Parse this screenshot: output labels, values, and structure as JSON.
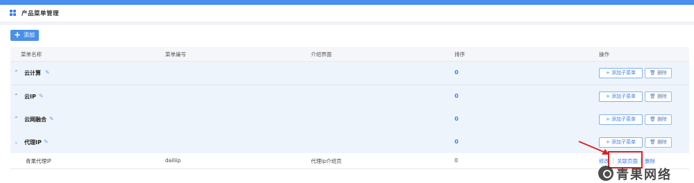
{
  "page": {
    "title": "产品菜单管理"
  },
  "toolbar": {
    "add_label": "添加"
  },
  "table": {
    "headers": [
      "菜单名称",
      "菜单编号",
      "介绍界面",
      "排序",
      "操作"
    ],
    "rows": [
      {
        "name": "云计算",
        "sort": "0",
        "expanded": false
      },
      {
        "name": "云IP",
        "sort": "0",
        "expanded": false
      },
      {
        "name": "云网融合",
        "sort": "0",
        "expanded": false
      },
      {
        "name": "代理IP",
        "sort": "0",
        "expanded": true
      }
    ],
    "row_actions": {
      "add_sub": "添加子菜单",
      "delete": "删除"
    },
    "child_row": {
      "name": "青果代理IP",
      "code": "dailiip",
      "intro": "代理ip介绍页",
      "sort": "0",
      "actions": {
        "edit": "修改",
        "link": "关联页面",
        "delete": "删除"
      }
    }
  },
  "watermark": {
    "text": "青果网络"
  },
  "colors": {
    "accent": "#4a90e8",
    "highlight": "#e02020"
  }
}
